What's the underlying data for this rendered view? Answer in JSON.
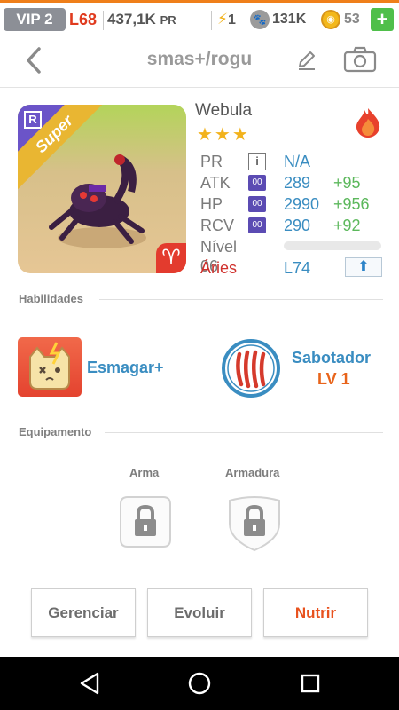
{
  "status": {
    "vip": "VIP 2",
    "level": "L68",
    "power": "437,1K",
    "power_unit": "PR",
    "energy": "1",
    "paws": "131K",
    "coins": "53",
    "add_label": "+"
  },
  "header": {
    "title": "smas+/rogu"
  },
  "monster": {
    "rarity": "Super",
    "rank_badge": "R",
    "sign_glyph": "♈",
    "name": "Webula",
    "stars": "★★★",
    "stats": {
      "pr_label": "PR",
      "pr_info": "i",
      "pr_value": "N/A",
      "atk_label": "ATK",
      "atk_tag": "00",
      "atk_value": "289",
      "atk_bonus": "+95",
      "hp_label": "HP",
      "hp_tag": "00",
      "hp_value": "2990",
      "hp_bonus": "+956",
      "rcv_label": "RCV",
      "rcv_tag": "00",
      "rcv_value": "290",
      "rcv_bonus": "+92",
      "level_label": "Nível 06",
      "level_progress": 0,
      "sign_name": "Áries",
      "max_level": "L74"
    }
  },
  "skills": {
    "title": "Habilidades",
    "items": [
      {
        "name": "Esmagar+",
        "level": ""
      },
      {
        "name": "Sabotador",
        "level": "LV 1"
      }
    ]
  },
  "equipment": {
    "title": "Equipamento",
    "weapon_label": "Arma",
    "armor_label": "Armadura"
  },
  "actions": {
    "manage": "Gerenciar",
    "evolve": "Evoluir",
    "feed": "Nutrir"
  },
  "colors": {
    "accent": "#3a8dc1",
    "bonus": "#5cb85c",
    "danger": "#e03b1f",
    "orange": "#e8521e"
  },
  "icons": {
    "back": "chevron-left-icon",
    "edit": "pencil-icon",
    "camera": "camera-icon",
    "element": "fire-icon",
    "lock": "lock-icon"
  }
}
